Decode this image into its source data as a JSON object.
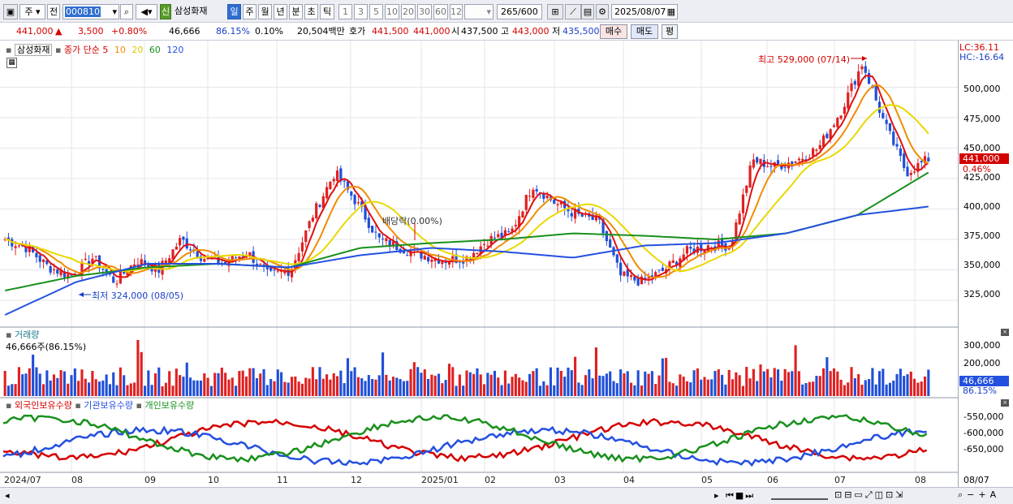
{
  "toolbar": {
    "period": "주",
    "prev": "전",
    "code": "000810",
    "credit_badge": "신",
    "name": "삼성화재",
    "intervals": [
      "일",
      "주",
      "월",
      "년",
      "분",
      "초",
      "틱"
    ],
    "active_interval": "일",
    "minutes": [
      "1",
      "3",
      "5",
      "10",
      "20",
      "30",
      "60",
      "120"
    ],
    "count": "265",
    "count_total": "/600",
    "date": "2025/08/07"
  },
  "quote": {
    "price": "441,000",
    "change_arrow": "▲",
    "change": "3,500",
    "change_pct": "+0.80%",
    "volume": "46,666",
    "vol_ratio": "86.15%",
    "turnover": "0.10%",
    "amount": "20,504백만",
    "bid_label": "호가",
    "bid1": "441,500",
    "bid2": "441,000",
    "open_label": "시",
    "open": "437,500",
    "high_label": "고",
    "high": "443,000",
    "low_label": "저",
    "low": "435,500",
    "buy": "매수",
    "sell": "매도",
    "eval": "평"
  },
  "legend": {
    "name": "삼성화재",
    "series": "종가 단순",
    "ma": [
      "5",
      "10",
      "20",
      "60",
      "120"
    ],
    "ma_colors": [
      "#e01010",
      "#f08c00",
      "#e8d800",
      "#18901c",
      "#2450e0"
    ]
  },
  "annotations": {
    "high": "최고 529,000 (07/14)",
    "low": "최저 324,000 (08/05)",
    "dividend": "배당락(0.00%)"
  },
  "price_axis": {
    "lc": "LC:36.11",
    "hc": "HC:-16.64",
    "ticks": [
      "500,000",
      "475,000",
      "450,000",
      "425,000",
      "400,000",
      "375,000",
      "350,000",
      "325,000"
    ],
    "current": "441,000",
    "current_pct": "0.46%"
  },
  "volume_panel": {
    "title": "거래량",
    "value": "46,666주(86.15%)",
    "ticks": [
      "300,000",
      "200,000"
    ],
    "current": "46,666",
    "current_pct": "86.15%"
  },
  "ownership_panel": {
    "items": [
      "외국인보유수량",
      "기관보유수량",
      "개인보유수량"
    ],
    "ticks": [
      "-550,000",
      "-600,000",
      "-650,000"
    ]
  },
  "x_axis": [
    "2024/07",
    "08",
    "09",
    "10",
    "11",
    "12",
    "2025/01",
    "02",
    "03",
    "04",
    "05",
    "06",
    "07",
    "08"
  ],
  "x_axis_last": "08/07",
  "chart_data": {
    "type": "candlestick",
    "title": "삼성화재",
    "ylim": [
      305000,
      535000
    ],
    "months": [
      "2024/07",
      "08",
      "09",
      "10",
      "11",
      "12",
      "2025/01",
      "02",
      "03",
      "04",
      "05",
      "06",
      "07",
      "08"
    ],
    "close_approx": [
      375000,
      368000,
      352000,
      345000,
      360000,
      340000,
      358000,
      350000,
      375000,
      360000,
      355000,
      365000,
      345000,
      350000,
      395000,
      430000,
      405000,
      375000,
      368000,
      362000,
      358000,
      360000,
      375000,
      380000,
      420000,
      405000,
      395000,
      390000,
      345000,
      340000,
      350000,
      365000,
      370000,
      370000,
      440000,
      435000,
      440000,
      450000,
      480000,
      520000,
      470000,
      430000,
      441000
    ],
    "ma120_approx": [
      313000,
      340000,
      355000,
      355000,
      352000,
      362000,
      368000,
      365000,
      360000,
      370000,
      372000,
      380000,
      395000,
      402000
    ],
    "ma60_approx": [
      333000,
      345000,
      352000,
      355000,
      352000,
      368000,
      372000,
      375000,
      380000,
      378000,
      375000,
      380000,
      395000,
      430000
    ],
    "high_point": {
      "label": "529,000",
      "date": "07/14"
    },
    "low_point": {
      "label": "324,000",
      "date": "08/05"
    }
  }
}
